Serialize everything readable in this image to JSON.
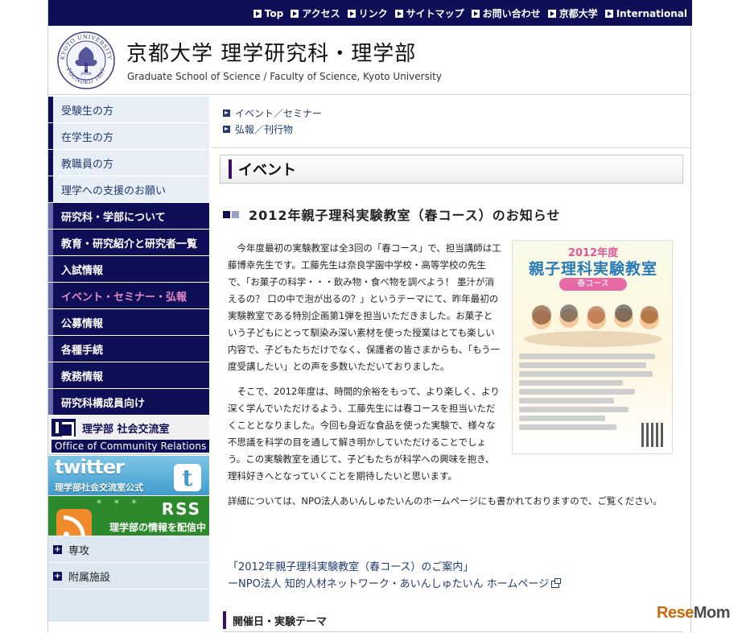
{
  "topnav": {
    "items": [
      "Top",
      "アクセス",
      "リンク",
      "サイトマップ",
      "お問い合わせ",
      "京都大学",
      "International"
    ]
  },
  "header": {
    "title": "京都大学 理学研究科・理学部",
    "subtitle": "Graduate School of Science / Faculty of Science, Kyoto University",
    "seal_top": "KYOTO UNIVERSITY",
    "seal_bottom": "FOUNDED 1897",
    "seal_center_line1": "KYOTO",
    "seal_center_line2": "JAPAN"
  },
  "sidebar": {
    "audience_items": [
      "受験生の方",
      "在学生の方",
      "教職員の方",
      "理学への支援のお願い"
    ],
    "main_items": [
      "研究科・学部について",
      "教育・研究紹介と研究者一覧",
      "入試情報",
      "イベント・セミナー・弘報",
      "公募情報",
      "各種手続",
      "教務情報",
      "研究科構成員向け"
    ],
    "active_index": 3,
    "banners": {
      "ocr_jp": "理学部 社会交流室",
      "ocr_en": "Office of Community Relations",
      "twitter_logo": "twitter",
      "twitter_sub": "理学部社会交流室公式",
      "rss_title": "RSS",
      "rss_sub": "理学部の情報を配信中"
    },
    "expand_items": [
      "専攻",
      "附属施設"
    ]
  },
  "main": {
    "sublinks": [
      "イベント／セミナー",
      "弘報／刊行物"
    ],
    "section_title": "イベント",
    "article_title": "2012年親子理科実験教室（春コース）のお知らせ",
    "paragraphs": [
      "　今年度最初の実験教室は全3回の「春コース」で、担当講師は工藤博幸先生です。工藤先生は奈良学園中学校・高等学校の先生で、「お菓子の科学・・・飲み物・食べ物を調べよう！ 墨汁が消えるの？ 口の中で泡が出るの？」というテーマにて、昨年最初の実験教室である特別企画第1弾を担当いただきました。お菓子という子どもにとって馴染み深い素材を使った授業はとても楽しい内容で、子どもたちだけでなく、保護者の皆さまからも、「もう一度受講したい」との声を多数いただいておりました。",
      "　そこで、2012年度は、時間的余裕をもって、より楽しく、より深く学んでいただけるよう、工藤先生には春コースを担当いただくこととなりました。今回も身近な食品を使った実験で、様々な不思議を科学の目を通して解き明かしていただけることでしょう。この実験教室を通じて、子どもたちが科学への興味を抱き、理科好きへとなっていくことを期待したいと思います。",
      "詳細については、NPO法人あいんしゅたいんのホームページにも書かれておりますので、ご覧ください。"
    ],
    "link_line1": "「2012年親子理科実験教室（春コース）のご案内」",
    "link_line2": "ーNPO法人 知的人材ネットワーク・あいんしゅたいん ホームページ",
    "sub_section": "開催日・実験テーマ",
    "flyer": {
      "line1": "2012年度",
      "line2": "親子理科実験教室",
      "line3": "春コース"
    }
  },
  "watermark": {
    "a": "Rese",
    "b": "Mom"
  },
  "colors": {
    "navy": "#0f0f58",
    "link": "#1f3b6f",
    "active_pink": "#e68ac8",
    "accent_purple": "#3d0f6b"
  }
}
